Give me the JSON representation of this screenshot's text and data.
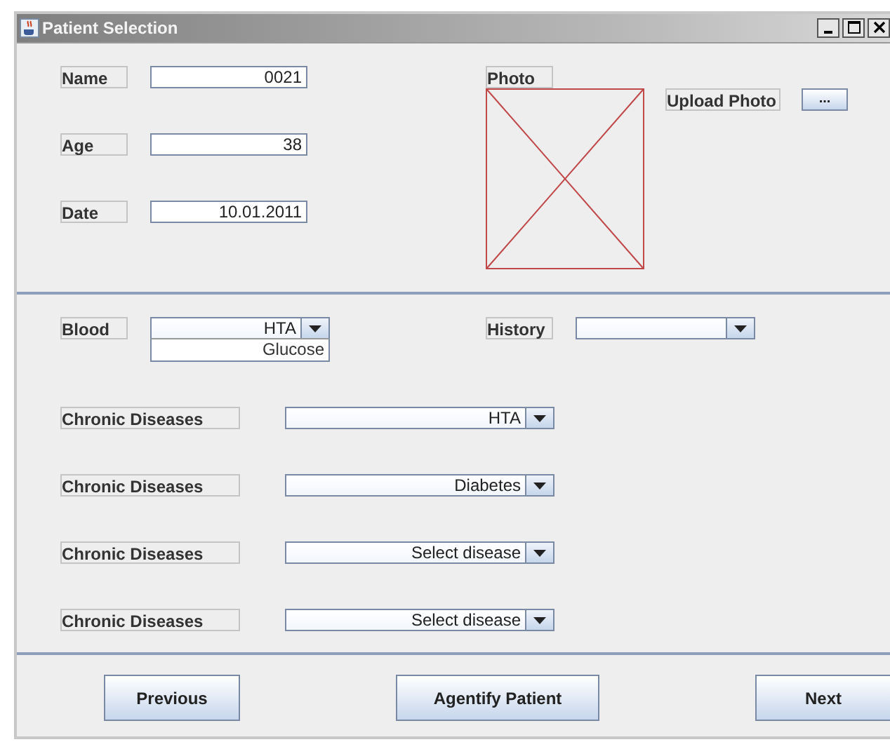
{
  "window": {
    "title": "Patient Selection"
  },
  "fields": [
    {
      "label": "Name",
      "value": "0021"
    },
    {
      "label": "Age",
      "value": "38"
    },
    {
      "label": "Date",
      "value": "10.01.2011"
    }
  ],
  "photo": {
    "label": "Photo",
    "upload_label": "Upload Photo",
    "browse_button": "..."
  },
  "blood": {
    "label": "Blood",
    "value": "HTA",
    "expanded": true,
    "options": [
      "Glucose"
    ]
  },
  "history": {
    "label": "History"
  },
  "chronic_diseases": [
    {
      "label": "Chronic Diseases",
      "value": "HTA"
    },
    {
      "label": "Chronic Diseases",
      "value": "Diabetes"
    },
    {
      "label": "Chronic Diseases",
      "value": "Select disease"
    },
    {
      "label": "Chronic Diseases",
      "value": "Select disease"
    }
  ],
  "buttons": [
    "Previous",
    "Agentify Patient",
    "Next"
  ]
}
